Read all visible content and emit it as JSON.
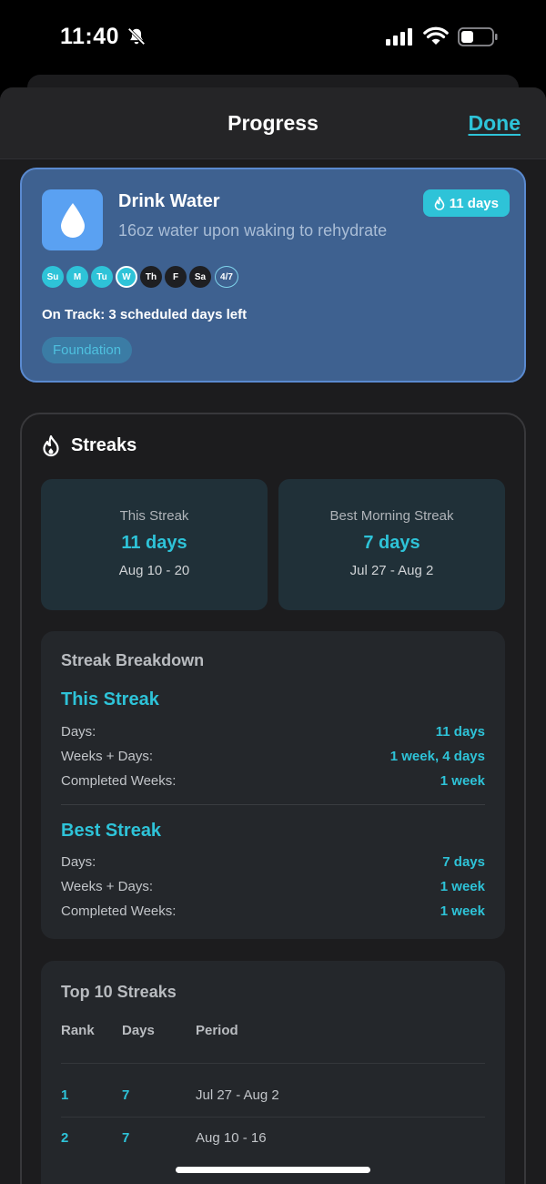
{
  "status_bar": {
    "time": "11:40"
  },
  "nav": {
    "title": "Progress",
    "done_label": "Done"
  },
  "habit": {
    "title": "Drink Water",
    "description": "16oz water upon waking to rehydrate",
    "streak_badge": "11 days",
    "days": [
      {
        "label": "Su",
        "state": "done"
      },
      {
        "label": "M",
        "state": "done"
      },
      {
        "label": "Tu",
        "state": "done"
      },
      {
        "label": "W",
        "state": "today"
      },
      {
        "label": "Th",
        "state": "future"
      },
      {
        "label": "F",
        "state": "future"
      },
      {
        "label": "Sa",
        "state": "future"
      }
    ],
    "week_count": "4/7",
    "status": "On Track: 3 scheduled days left",
    "tag": "Foundation"
  },
  "streaks": {
    "title": "Streaks",
    "this_streak": {
      "label": "This Streak",
      "value": "11 days",
      "range": "Aug 10 - 20"
    },
    "best_streak": {
      "label": "Best Morning Streak",
      "value": "7 days",
      "range": "Jul 27 - Aug 2"
    },
    "breakdown": {
      "title": "Streak Breakdown",
      "this": {
        "title": "This Streak",
        "days_label": "Days:",
        "days_value": "11 days",
        "weeks_days_label": "Weeks + Days:",
        "weeks_days_value": "1 week, 4 days",
        "completed_label": "Completed Weeks:",
        "completed_value": "1 week"
      },
      "best": {
        "title": "Best Streak",
        "days_label": "Days:",
        "days_value": "7 days",
        "weeks_days_label": "Weeks + Days:",
        "weeks_days_value": "1 week",
        "completed_label": "Completed Weeks:",
        "completed_value": "1 week"
      }
    },
    "top10": {
      "title": "Top 10 Streaks",
      "headers": {
        "rank": "Rank",
        "days": "Days",
        "period": "Period"
      },
      "rows": [
        {
          "rank": "1",
          "days": "7",
          "period": "Jul 27 - Aug 2"
        },
        {
          "rank": "2",
          "days": "7",
          "period": "Aug 10 - 16"
        }
      ]
    }
  },
  "colors": {
    "accent": "#2ec3d8",
    "card": "#3e6190",
    "background": "#1c1c1e"
  }
}
